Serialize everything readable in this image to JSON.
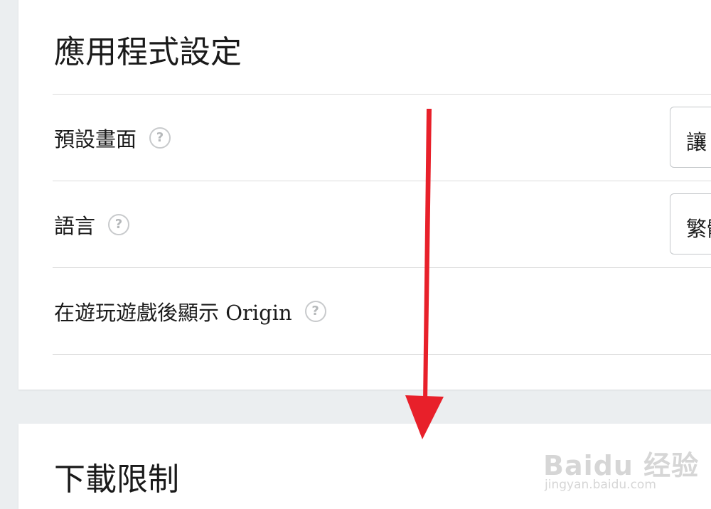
{
  "app_settings": {
    "title": "應用程式設定",
    "rows": [
      {
        "label": "預設畫面",
        "help": "?",
        "select_value": "讓"
      },
      {
        "label": "語言",
        "help": "?",
        "select_value": "繁體"
      },
      {
        "label": "在遊玩遊戲後顯示 Origin",
        "help": "?"
      }
    ]
  },
  "download_limits": {
    "title": "下載限制"
  },
  "annotation": {
    "arrow_color": "#e8202a"
  },
  "watermark": {
    "logo_text": "Baidu 经验",
    "url": "jingyan.baidu.com"
  }
}
